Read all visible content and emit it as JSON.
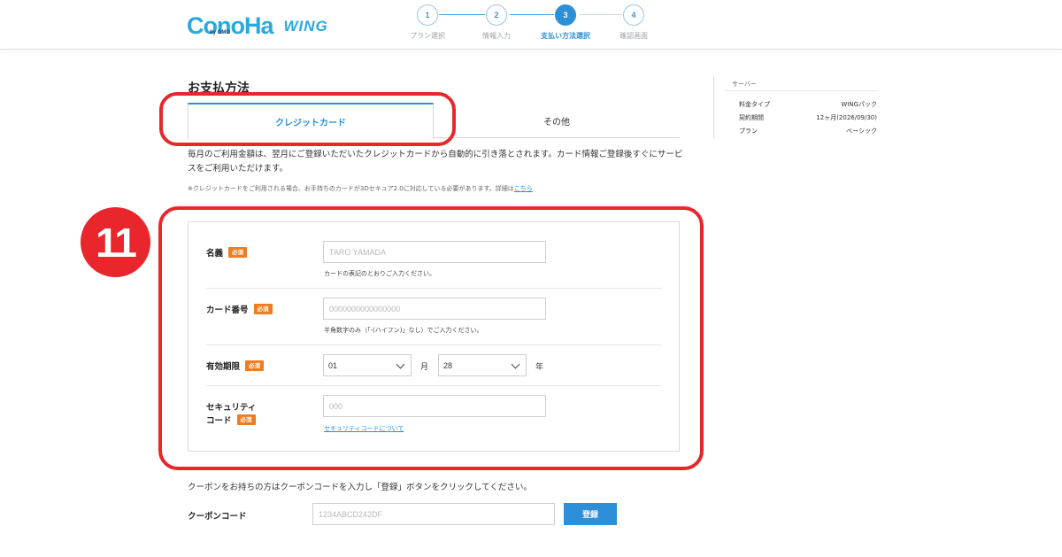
{
  "header": {
    "logo_main": "ConoHa",
    "logo_by": "by GMO",
    "logo_wing": "WING",
    "steps": [
      {
        "number": "1",
        "label": "プラン選択"
      },
      {
        "number": "2",
        "label": "情報入力"
      },
      {
        "number": "3",
        "label": "支払い方法選択"
      },
      {
        "number": "4",
        "label": "確認画面"
      }
    ],
    "active_step": 3
  },
  "main": {
    "title": "お支払方法",
    "tabs": [
      {
        "label": "クレジットカード",
        "active": true
      },
      {
        "label": "その他",
        "active": false
      }
    ],
    "description": "毎月のご利用金額は、翌月にご登録いただいたクレジットカードから自動的に引き落とされます。カード情報ご登録後すぐにサービスをご利用いただけます。",
    "note_text": "※クレジットカードをご利用される場合、お手持ちのカードが3Dセキュア2.0に対応している必要があります。詳細は",
    "note_link": "こちら"
  },
  "form": {
    "required_badge": "必須",
    "name": {
      "label": "名義",
      "placeholder": "TARO YAMADA",
      "help": "カードの表記のとおりご入力ください。"
    },
    "card_number": {
      "label": "カード番号",
      "placeholder": "0000000000000000",
      "help": "半角数字のみ（「-(ハイフン)」なし）でご入力ください。"
    },
    "expiry": {
      "label": "有効期限",
      "month_value": "01",
      "month_unit": "月",
      "year_value": "28",
      "year_unit": "年"
    },
    "security": {
      "label_line1": "セキュリティ",
      "label_line2": "コード",
      "placeholder": "000",
      "help_link": "セキュリティコードについて"
    }
  },
  "summary": {
    "title": "サーバー",
    "rows": [
      {
        "key": "料金タイプ",
        "value": "WINGパック"
      },
      {
        "key": "契約期間",
        "value": "12ヶ月(2026/09/30)"
      },
      {
        "key": "プラン",
        "value": "ベーシック"
      }
    ]
  },
  "coupon": {
    "text": "クーポンをお持ちの方はクーポンコードを入力し「登録」ボタンをクリックしてください。",
    "label": "クーポンコード",
    "placeholder": "1234ABCD242DF",
    "button": "登録"
  },
  "annotation": {
    "badge_number": "11",
    "color": "#e8262c"
  },
  "colors": {
    "accent": "#2c8fd8",
    "brand": "#29a9e0",
    "required": "#f07c1e"
  }
}
